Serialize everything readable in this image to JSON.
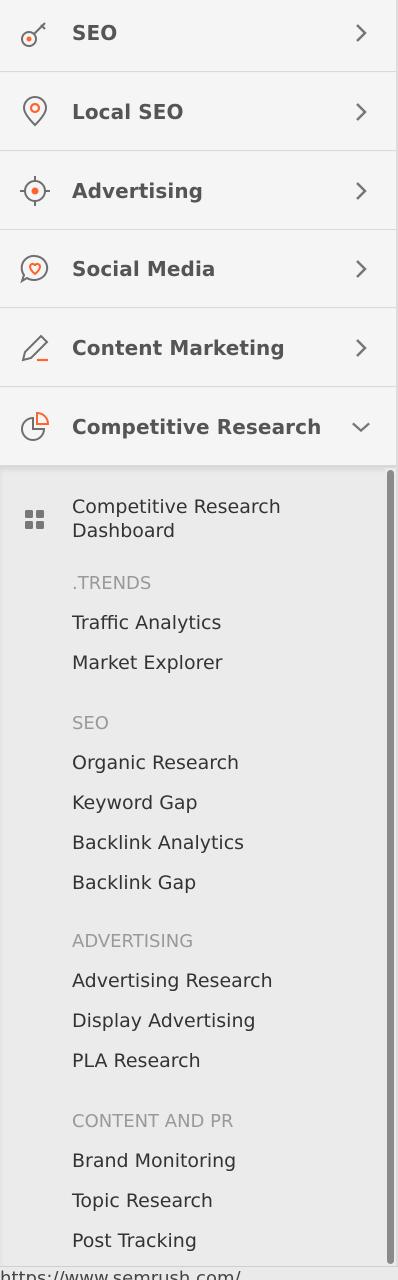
{
  "menu": {
    "items": [
      {
        "label": "SEO",
        "icon": "key-icon",
        "expanded": false
      },
      {
        "label": "Local SEO",
        "icon": "map-pin-icon",
        "expanded": false
      },
      {
        "label": "Advertising",
        "icon": "target-icon",
        "expanded": false
      },
      {
        "label": "Social Media",
        "icon": "chat-heart-icon",
        "expanded": false
      },
      {
        "label": "Content Marketing",
        "icon": "pencil-icon",
        "expanded": false
      },
      {
        "label": "Competitive Research",
        "icon": "pie-chart-icon",
        "expanded": true
      }
    ]
  },
  "submenu": {
    "dashboard_line1": "Competitive Research",
    "dashboard_line2": "Dashboard",
    "sections": [
      {
        "heading": ".TRENDS",
        "items": [
          "Traffic Analytics",
          "Market Explorer"
        ]
      },
      {
        "heading": "SEO",
        "items": [
          "Organic Research",
          "Keyword Gap",
          "Backlink Analytics",
          "Backlink Gap"
        ]
      },
      {
        "heading": "ADVERTISING",
        "items": [
          "Advertising Research",
          "Display Advertising",
          "PLA Research"
        ]
      },
      {
        "heading": "CONTENT AND PR",
        "items": [
          "Brand Monitoring",
          "Topic Research",
          "Post Tracking"
        ]
      }
    ]
  },
  "status_bar": {
    "url": "https://www.semrush.com/"
  },
  "colors": {
    "accent": "#ff642d",
    "icon_gray": "#6e6e6e"
  }
}
